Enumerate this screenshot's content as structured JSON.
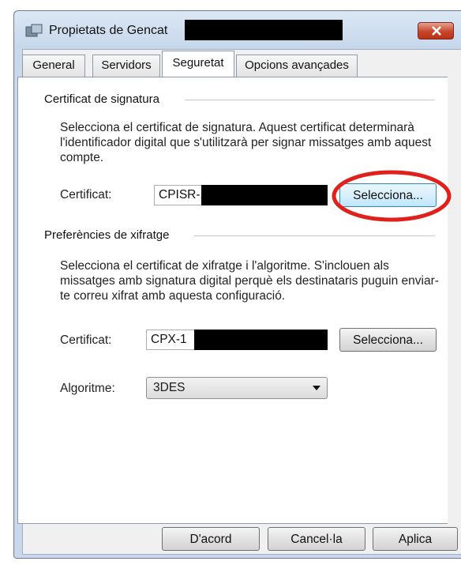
{
  "window": {
    "title": "Propietats de Gencat"
  },
  "tabs": [
    {
      "label": "General",
      "active": false
    },
    {
      "label": "Servidors",
      "active": false
    },
    {
      "label": "Seguretat",
      "active": true
    },
    {
      "label": "Opcions avançades",
      "active": false
    }
  ],
  "signature": {
    "section_title": "Certificat de signatura",
    "description": "Selecciona el certificat de signatura. Aquest certificat determinarà l'identificador digital que s'utilitzarà per signar missatges amb aquest compte.",
    "cert_label": "Certificat:",
    "cert_value": "CPISR-1",
    "select_button": "Selecciona..."
  },
  "encryption": {
    "section_title": "Preferències de xifratge",
    "description": "Selecciona el certificat de xifratge i l'algoritme. S'inclouen als missatges amb signatura digital perquè els destinataris puguin enviar-te correu xifrat amb aquesta configuració.",
    "cert_label": "Certificat:",
    "cert_value": "CPX-1",
    "select_button": "Selecciona...",
    "algorithm_label": "Algoritme:",
    "algorithm_value": "3DES"
  },
  "footer": {
    "ok": "D'acord",
    "cancel": "Cancel·la",
    "apply": "Aplica"
  },
  "colors": {
    "highlight_circle": "#e0201a",
    "close_button": "#c7462c"
  }
}
